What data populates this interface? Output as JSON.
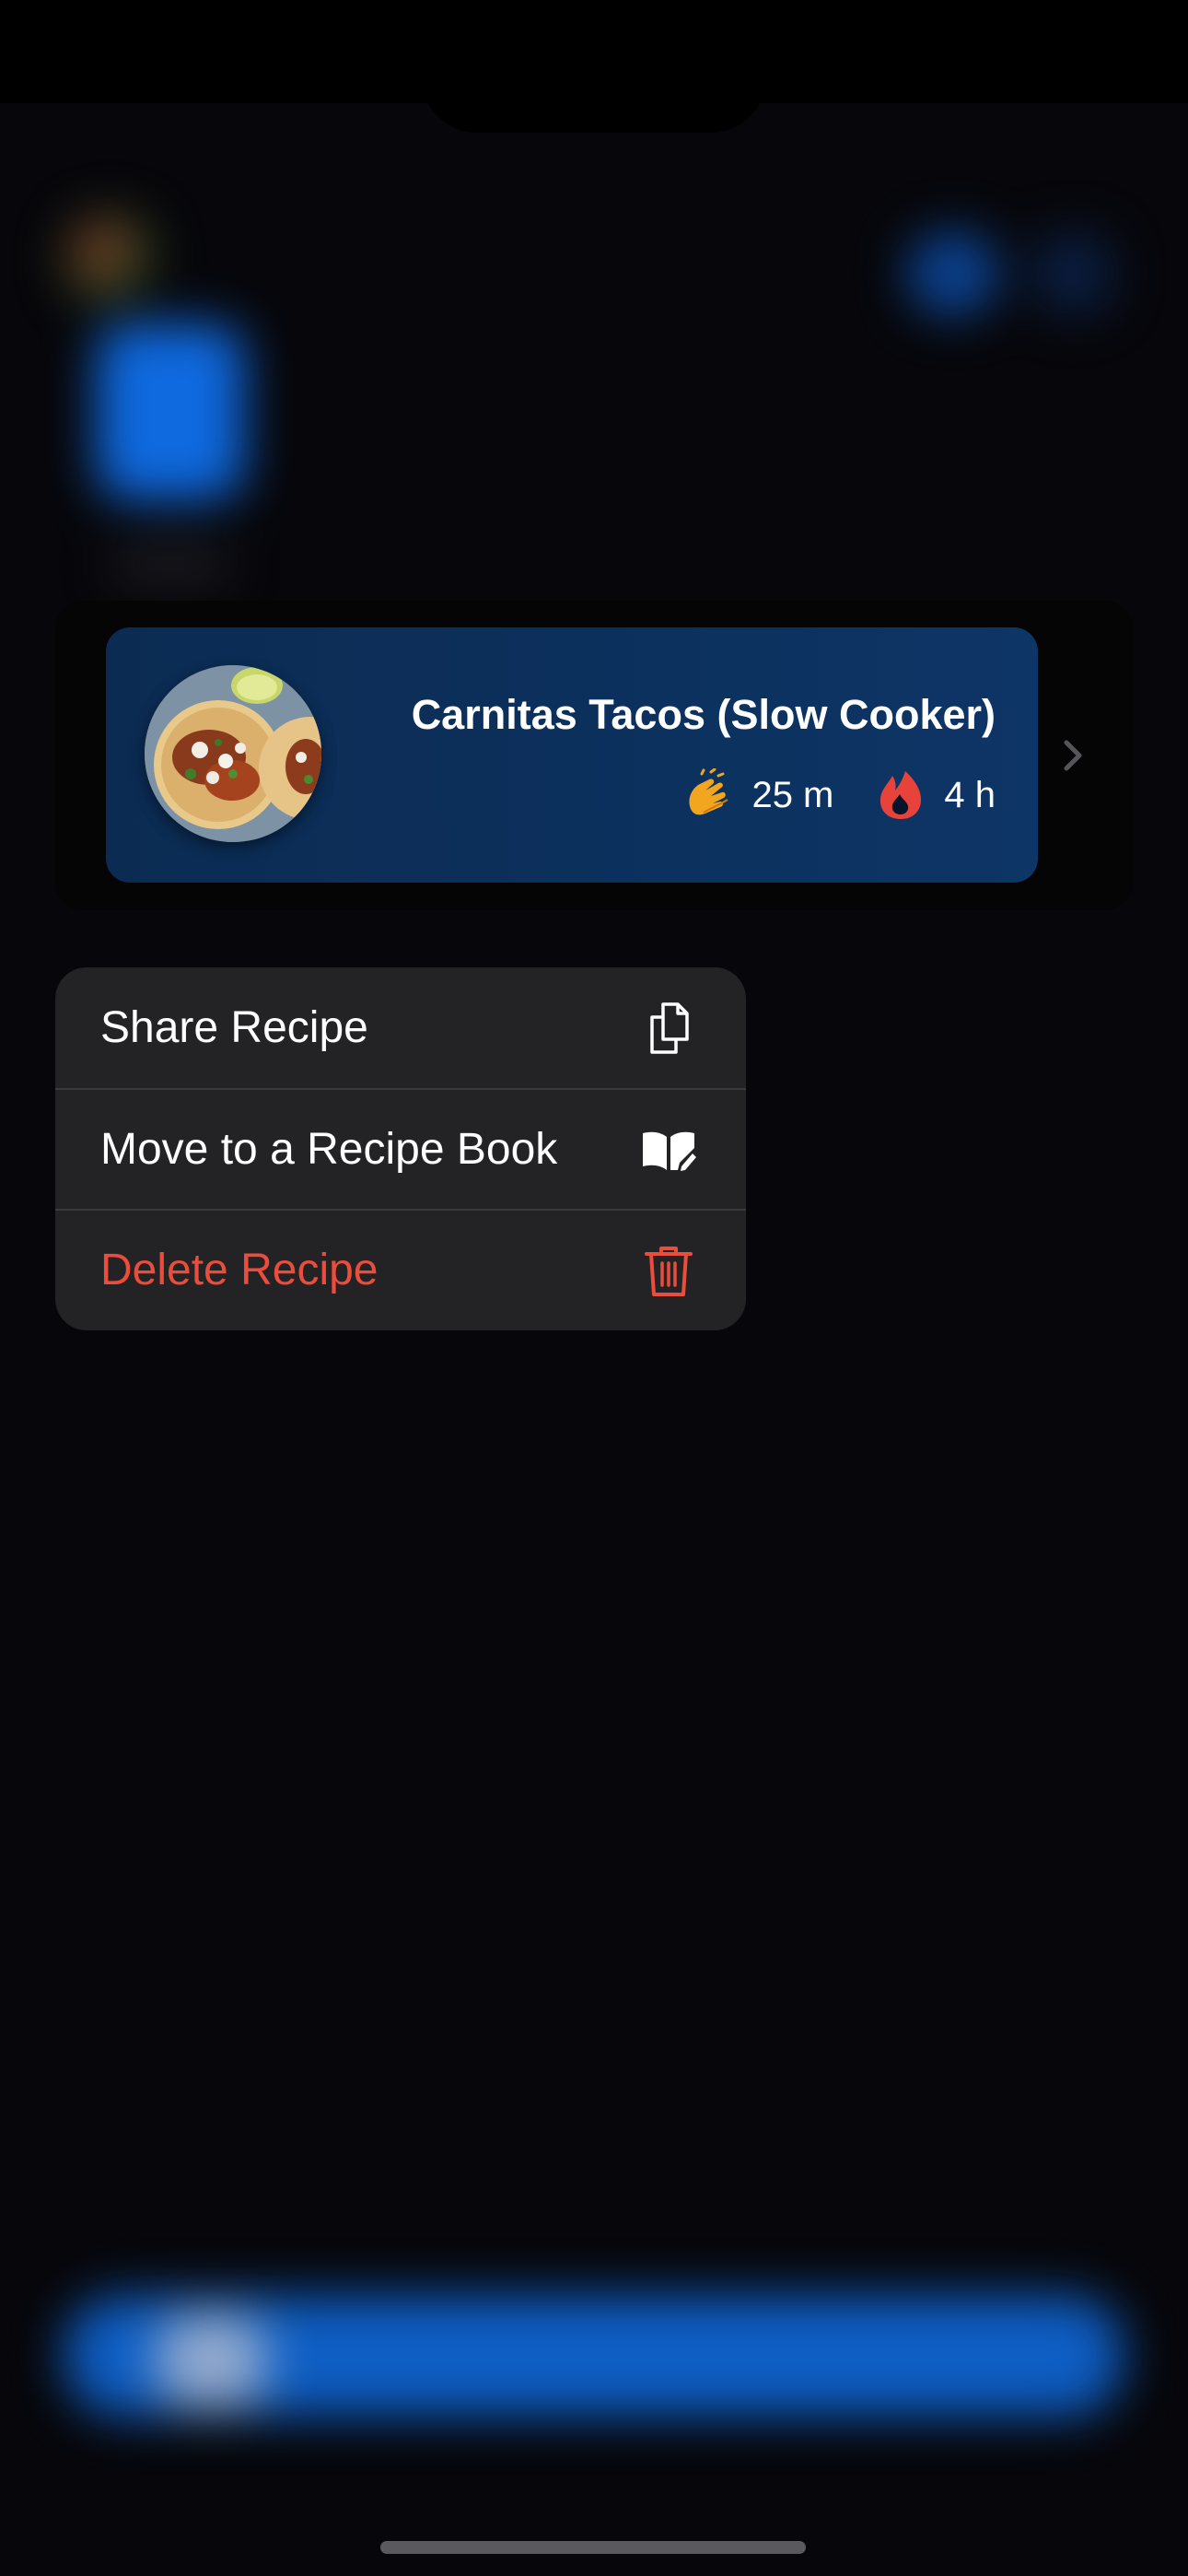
{
  "recipe": {
    "title": "Carnitas Tacos (Slow Cooker)",
    "prep_time": "25 m",
    "cook_time": "4 h",
    "prep_icon": "clapping-hands-icon",
    "cook_icon": "fire-icon"
  },
  "context_menu": {
    "items": [
      {
        "label": "Share Recipe",
        "icon": "copy-document-icon",
        "destructive": false
      },
      {
        "label": "Move to a Recipe Book",
        "icon": "book-edit-icon",
        "destructive": false
      },
      {
        "label": "Delete Recipe",
        "icon": "trash-icon",
        "destructive": true
      }
    ]
  },
  "colors": {
    "background": "#07070b",
    "card": "#0d3566",
    "menu": "#232325",
    "destructive": "#eb4d3d",
    "accent_orange": "#f2a61f",
    "flame_red": "#e8433a"
  }
}
